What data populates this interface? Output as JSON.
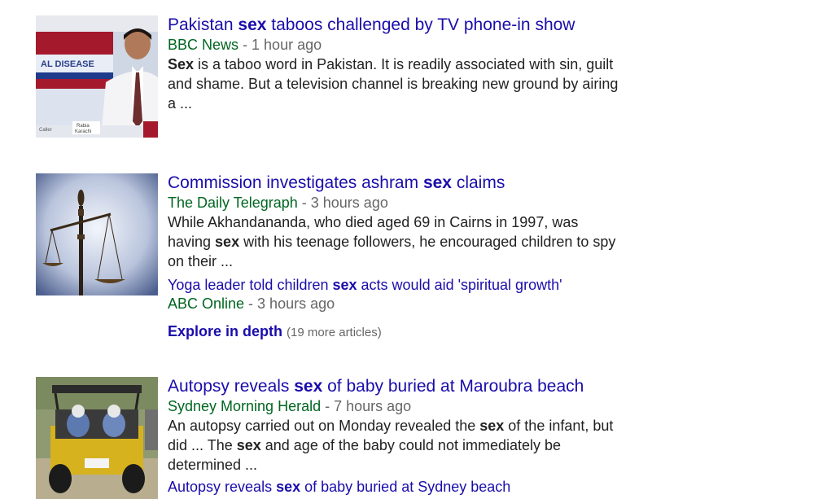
{
  "results": [
    {
      "title": {
        "pre": "Pakistan ",
        "bold": "sex",
        "post": " taboos challenged by TV phone-in show"
      },
      "source": "BBC News",
      "separator": " - ",
      "time": "1 hour ago",
      "snippet": {
        "line1": {
          "bold": "Sex",
          "post": " is a taboo word in Pakistan. It is readily associated with sin, guilt"
        },
        "line2": "and shame. But a television channel is breaking new ground by airing",
        "line3": "a ..."
      },
      "thumb": {
        "caption": "AL DISEASE",
        "chip1": "Rabia",
        "chip2": "Karachi",
        "chip3": "Caller"
      }
    },
    {
      "title": {
        "pre": "Commission investigates ashram ",
        "bold": "sex",
        "post": " claims"
      },
      "source": "The Daily Telegraph",
      "separator": " - ",
      "time": "3 hours ago",
      "snippet": {
        "line1": "While Akhandananda, who died aged 69 in Cairns in 1997, was",
        "line2": {
          "pre": "having ",
          "bold": "sex",
          "post": " with his teenage followers, he encouraged children to spy"
        },
        "line3": "on their ..."
      },
      "related": {
        "title": {
          "pre": "Yoga leader told children ",
          "bold": "sex",
          "post": " acts would aid 'spiritual growth'"
        },
        "source": "ABC Online",
        "separator": " - ",
        "time": "3 hours ago"
      },
      "depth": {
        "label": "Explore in depth",
        "count": "(19 more articles)"
      }
    },
    {
      "title": {
        "pre": "Autopsy reveals ",
        "bold": "sex",
        "post": " of baby buried at Maroubra beach"
      },
      "source": "Sydney Morning Herald",
      "separator": " - ",
      "time": "7 hours ago",
      "snippet": {
        "line1": {
          "pre": "An autopsy carried out on Monday revealed the ",
          "bold": "sex",
          "post": " of the infant, but"
        },
        "line2": {
          "pre": "did ... The ",
          "bold": "sex",
          "post": " and age of the baby could not immediately be"
        },
        "line3": "determined ..."
      },
      "related": {
        "title": {
          "pre": "Autopsy reveals ",
          "bold": "sex",
          "post": " of baby buried at Sydney beach"
        }
      }
    }
  ]
}
